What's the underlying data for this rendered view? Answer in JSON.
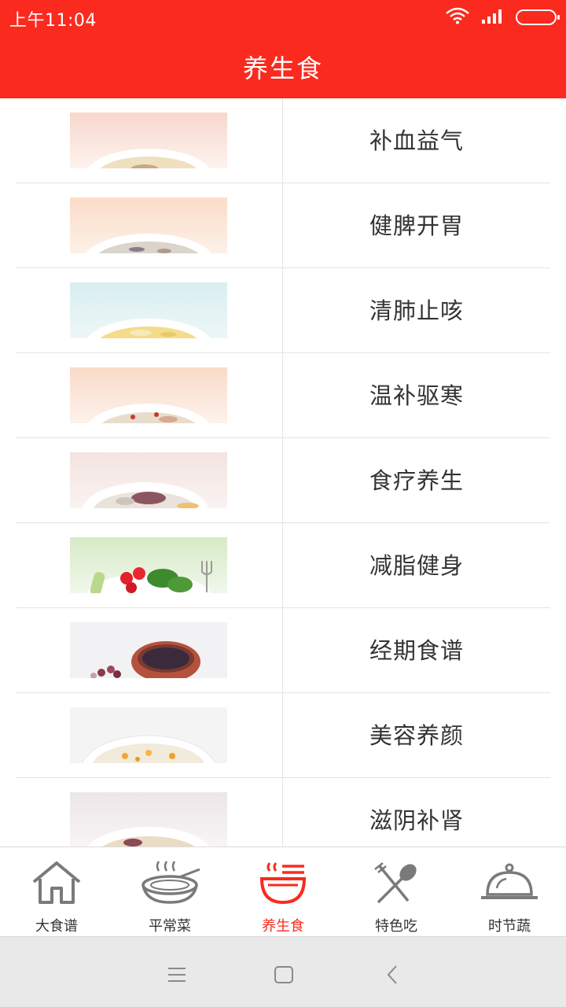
{
  "status_bar": {
    "time": "上午11:04"
  },
  "title": "养生食",
  "categories": [
    {
      "label": "补血益气",
      "image": "porridge-bowl"
    },
    {
      "label": "健脾开胃",
      "image": "porridge-bowl"
    },
    {
      "label": "清肺止咳",
      "image": "soup-bowl"
    },
    {
      "label": "温补驱寒",
      "image": "clay-pot-soup"
    },
    {
      "label": "食疗养生",
      "image": "meat-soup"
    },
    {
      "label": "减脂健身",
      "image": "vegetable-plate"
    },
    {
      "label": "经期食谱",
      "image": "bean-soup-pot"
    },
    {
      "label": "美容养颜",
      "image": "pumpkin-porridge"
    },
    {
      "label": "滋阴补肾",
      "image": "meat-soup"
    }
  ],
  "bottom_nav": [
    {
      "label": "大食谱",
      "icon": "home-icon",
      "active": false
    },
    {
      "label": "平常菜",
      "icon": "noodle-bowl-icon",
      "active": false
    },
    {
      "label": "养生食",
      "icon": "soup-bowl-icon",
      "active": true
    },
    {
      "label": "特色吃",
      "icon": "fork-spoon-icon",
      "active": false
    },
    {
      "label": "时节蔬",
      "icon": "cloche-icon",
      "active": false
    }
  ],
  "colors": {
    "brand": "#fb2a1e",
    "text": "#333333",
    "divider": "#e4e4e4"
  },
  "system_nav": [
    "menu-icon",
    "home-square-icon",
    "back-icon"
  ]
}
